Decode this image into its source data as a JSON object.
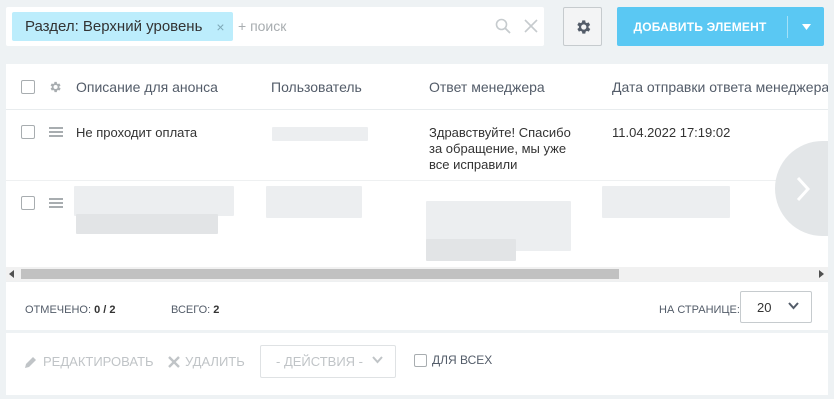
{
  "filter": {
    "chip_label": "Раздел: Верхний уровень",
    "chip_close": "×",
    "search_placeholder": "+ поиск"
  },
  "toolbar": {
    "add_label": "ДОБАВИТЬ ЭЛЕМЕНТ"
  },
  "grid": {
    "columns": [
      "Описание для анонса",
      "Пользователь",
      "Ответ менеджера",
      "Дата отправки ответа менеджера"
    ],
    "rows": [
      {
        "description": "Не проходит оплата",
        "user": "",
        "reply_line1": "Здравствуйте! Спасибо",
        "reply_line2": "за обращение, мы уже",
        "reply_line3": "все исправили",
        "date": "11.04.2022 17:19:02"
      }
    ]
  },
  "footer": {
    "selected_label": "ОТМЕЧЕНО:",
    "selected_value": "0 / 2",
    "total_label": "ВСЕГО:",
    "total_value": "2",
    "per_page_label": "НА СТРАНИЦЕ:",
    "per_page_value": "20"
  },
  "actions": {
    "edit_label": "РЕДАКТИРОВАТЬ",
    "delete_label": "УДАЛИТЬ",
    "actions_select": "- ДЕЙСТВИЯ -",
    "for_all_label": "ДЛЯ ВСЕХ"
  },
  "colors": {
    "accent": "#5ac8f3",
    "chip_bg": "#bcedfc",
    "page_bg": "#eef2f4"
  }
}
